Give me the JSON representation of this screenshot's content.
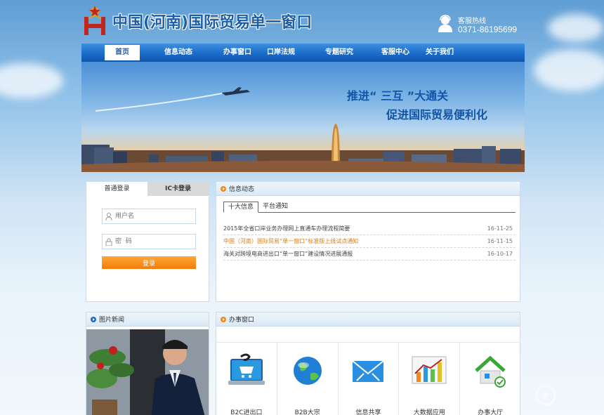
{
  "header": {
    "title": "中国(河南)国际贸易单一窗口",
    "hotline_label": "客服热线",
    "hotline_number": "0371-86195699"
  },
  "nav": {
    "items": [
      {
        "label": "首页",
        "active": true
      },
      {
        "label": "信息动态",
        "active": false
      },
      {
        "label": "办事窗口",
        "active": false
      },
      {
        "label": "口岸法规",
        "active": false
      },
      {
        "label": "专题研究",
        "active": false
      },
      {
        "label": "客服中心",
        "active": false
      },
      {
        "label": "关于我们",
        "active": false
      }
    ]
  },
  "banner": {
    "line1": "推进“ 三互 ”大通关",
    "line2": "促进国际贸易便利化"
  },
  "login": {
    "tab_normal": "普通登录",
    "tab_ic": "IC卡登录",
    "username_placeholder": "用户名",
    "password_placeholder": "密  码",
    "submit_label": "登录"
  },
  "info": {
    "title": "信息动态",
    "tabs": [
      "十大信息",
      "平台通知"
    ],
    "news": [
      {
        "title": "2015年全省口岸业务办理网上直通车办理流程简要",
        "date": "16-11-25",
        "highlight": false
      },
      {
        "title": "中国（河南）国际贸易“单一窗口”标准版上线试点通知",
        "date": "16-11-15",
        "highlight": true
      },
      {
        "title": "海关对跨境电商进出口“单一窗口”建设情况进展通报",
        "date": "16-10-17",
        "highlight": false
      }
    ]
  },
  "photo_news": {
    "title": "图片新闻",
    "dot_count": 6,
    "active_dot": 5
  },
  "services": {
    "title": "办事窗口",
    "items": [
      {
        "label": "B2C进出口",
        "icon": "laptop-cart-icon"
      },
      {
        "label": "B2B大宗",
        "icon": "globe-icon"
      },
      {
        "label": "信息共享",
        "icon": "mail-exchange-icon"
      },
      {
        "label": "大数据应用",
        "icon": "bar-chart-icon"
      },
      {
        "label": "办事大厅",
        "icon": "house-icon"
      }
    ]
  },
  "colors": {
    "brand_blue": "#1a5fa8",
    "nav_blue": "#1a6cc9",
    "accent_orange": "#f27d0c"
  }
}
